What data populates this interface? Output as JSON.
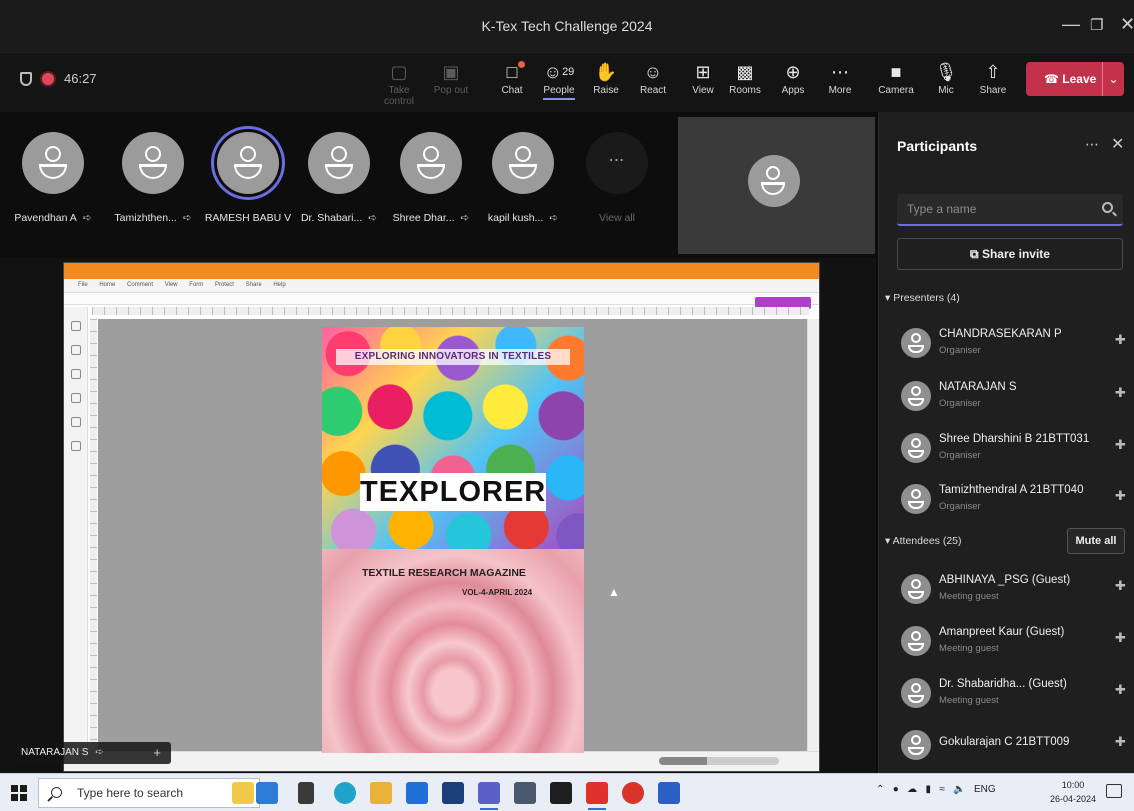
{
  "window": {
    "title": "K-Tex Tech Challenge 2024"
  },
  "toolbar": {
    "timer": "46:27",
    "buttons": [
      {
        "label": "Take control",
        "icon": "take-control-icon",
        "state": "disabled"
      },
      {
        "label": "Pop out",
        "icon": "pop-out-icon",
        "state": "disabled"
      },
      {
        "label": "Chat",
        "icon": "chat-icon"
      },
      {
        "label": "People",
        "icon": "people-icon",
        "count": "29",
        "state": "active"
      },
      {
        "label": "Raise",
        "icon": "raise-hand-icon"
      },
      {
        "label": "React",
        "icon": "react-icon"
      },
      {
        "label": "View",
        "icon": "view-icon"
      },
      {
        "label": "Rooms",
        "icon": "rooms-icon"
      },
      {
        "label": "Apps",
        "icon": "apps-icon"
      },
      {
        "label": "More",
        "icon": "more-icon"
      },
      {
        "label": "Camera",
        "icon": "camera-off-icon"
      },
      {
        "label": "Mic",
        "icon": "mic-off-icon"
      },
      {
        "label": "Share",
        "icon": "share-icon"
      }
    ],
    "leave_label": "Leave",
    "accent": "#c4314b"
  },
  "strip": {
    "participants": [
      {
        "name": "Pavendhan A",
        "speaking": false
      },
      {
        "name": "Tamizhthen...",
        "speaking": false
      },
      {
        "name": "RAMESH BABU V",
        "speaking": true
      },
      {
        "name": "Dr. Shabari...",
        "speaking": false
      },
      {
        "name": "Shree Dhar...",
        "speaking": false
      },
      {
        "name": "kapil kush...",
        "speaking": false
      }
    ],
    "view_all_label": "View all"
  },
  "shared_screen": {
    "presenter_name": "NATARAJAN S",
    "pdf_menu": [
      "File",
      "Home",
      "Comment",
      "View",
      "Form",
      "Protect",
      "Share",
      "Help"
    ],
    "magazine": {
      "tagline": "EXPLORING INNOVATORS IN TEXTILES",
      "title": "TEXPLORER",
      "subtitle": "TEXTILE RESEARCH MAGAZINE",
      "issue": "VOL-4-APRIL 2024"
    }
  },
  "panel": {
    "title": "Participants",
    "search_placeholder": "Type a name",
    "share_invite_label": "Share invite",
    "presenters_label": "Presenters (4)",
    "attendees_label": "Attendees (25)",
    "mute_all_label": "Mute all",
    "presenters": [
      {
        "name": "CHANDRASEKARAN P",
        "role": "Organiser"
      },
      {
        "name": "NATARAJAN S",
        "role": "Organiser"
      },
      {
        "name": "Shree Dharshini B 21BTT031",
        "role": "Organiser"
      },
      {
        "name": "Tamizhthendral A 21BTT040",
        "role": "Organiser"
      }
    ],
    "attendees": [
      {
        "name": "ABHINAYA _PSG (Guest)",
        "role": "Meeting guest"
      },
      {
        "name": "Amanpreet Kaur (Guest)",
        "role": "Meeting guest"
      },
      {
        "name": "Dr. Shabaridha... (Guest)",
        "role": "Meeting guest"
      },
      {
        "name": "Gokularajan C 21BTT009",
        "role": ""
      }
    ]
  },
  "taskbar": {
    "search_placeholder": "Type here to search",
    "tray_lang": "ENG",
    "time": "10:00",
    "date": "26-04-2024"
  }
}
